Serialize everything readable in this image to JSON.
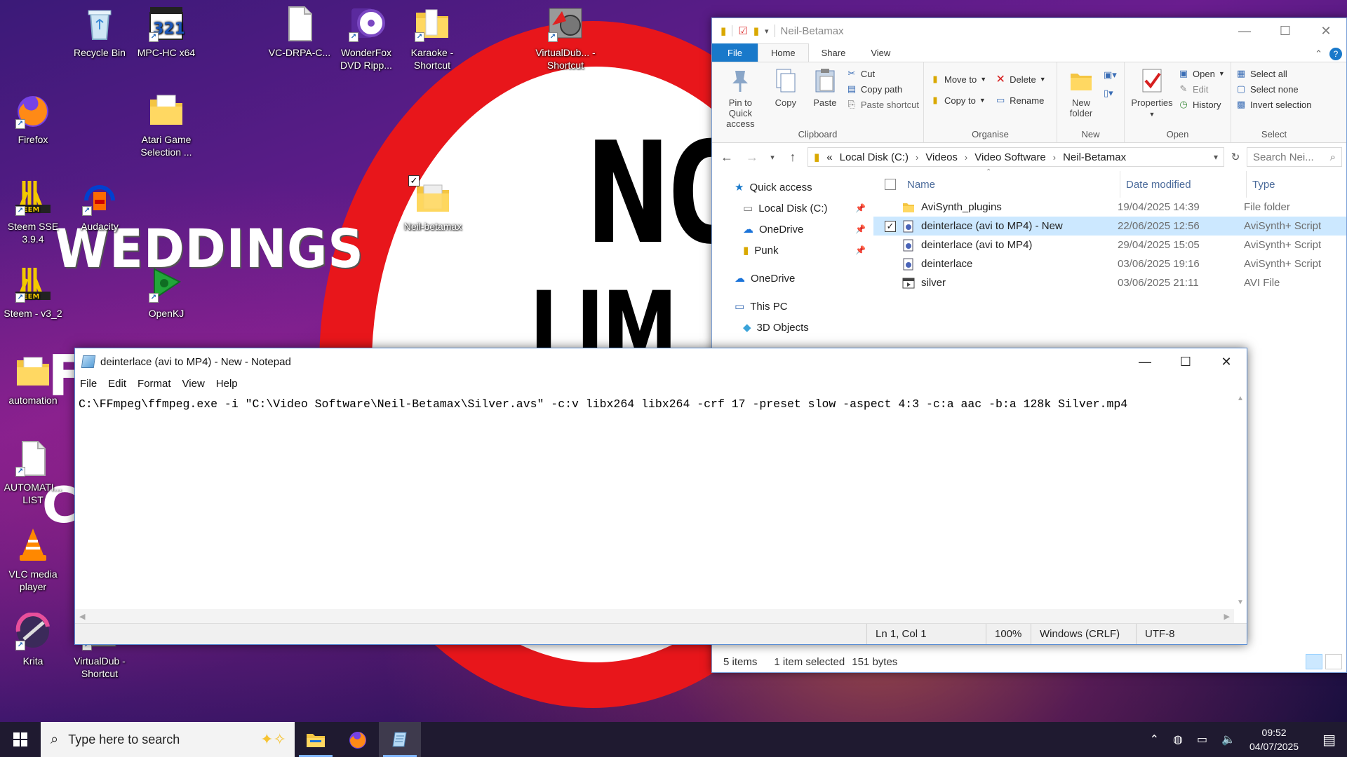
{
  "wallpaper": {
    "sign_top": "NO",
    "sign_bottom": "LIM",
    "weddings": "WEDDINGS",
    "frag1": "F",
    "frag2": "C"
  },
  "desktop_icons": [
    {
      "label": "Recycle Bin",
      "icon": "recycle-bin-icon"
    },
    {
      "label": "MPC-HC x64",
      "icon": "mpc-hc-icon"
    },
    {
      "label": "VC-DRPA-C...",
      "icon": "document-icon"
    },
    {
      "label": "WonderFox DVD Ripp...",
      "icon": "wonderfox-icon"
    },
    {
      "label": "Karaoke - Shortcut",
      "icon": "folder-icon"
    },
    {
      "label": "VirtualDub... - Shortcut",
      "icon": "virtualdub-icon"
    },
    {
      "label": "Firefox",
      "icon": "firefox-icon"
    },
    {
      "label": "Atari Game Selection ...",
      "icon": "folder-icon"
    },
    {
      "label": "Neil-betamax",
      "icon": "folder-icon"
    },
    {
      "label": "Steem SSE 3.9.4",
      "icon": "steem-icon"
    },
    {
      "label": "Audacity",
      "icon": "audacity-icon"
    },
    {
      "label": "Steem - v3_2",
      "icon": "steem-icon"
    },
    {
      "label": "OpenKJ",
      "icon": "openkj-icon"
    },
    {
      "label": "automation",
      "icon": "folder-icon"
    },
    {
      "label": "AUTOMATI... LIST",
      "icon": "document-icon"
    },
    {
      "label": "VLC media player",
      "icon": "vlc-icon"
    },
    {
      "label": "Krita",
      "icon": "krita-icon"
    },
    {
      "label": "VirtualDub - Shortcut",
      "icon": "virtualdub-icon"
    }
  ],
  "explorer": {
    "title": "Neil-Betamax",
    "tabs": {
      "file": "File",
      "home": "Home",
      "share": "Share",
      "view": "View"
    },
    "ribbon": {
      "clipboard": {
        "name": "Clipboard",
        "pin": "Pin to Quick access",
        "copy": "Copy",
        "paste": "Paste",
        "cut": "Cut",
        "copy_path": "Copy path",
        "paste_shortcut": "Paste shortcut"
      },
      "organise": {
        "name": "Organise",
        "move_to": "Move to",
        "copy_to": "Copy to",
        "delete": "Delete",
        "rename": "Rename"
      },
      "new": {
        "name": "New",
        "new_folder": "New folder"
      },
      "open": {
        "name": "Open",
        "properties": "Properties",
        "open": "Open",
        "edit": "Edit",
        "history": "History"
      },
      "select": {
        "name": "Select",
        "select_all": "Select all",
        "select_none": "Select none",
        "invert": "Invert selection"
      }
    },
    "address": {
      "prefix": "«",
      "crumbs": [
        "Local Disk (C:)",
        "Videos",
        "Video Software",
        "Neil-Betamax"
      ]
    },
    "search_placeholder": "Search Nei...",
    "nav": {
      "quick_access": "Quick access",
      "local_disk": "Local Disk (C:)",
      "onedrive1": "OneDrive",
      "punk": "Punk",
      "onedrive2": "OneDrive",
      "this_pc": "This PC",
      "objects3d": "3D Objects"
    },
    "columns": {
      "name": "Name",
      "date": "Date modified",
      "type": "Type"
    },
    "files": [
      {
        "name": "AviSynth_plugins",
        "date": "19/04/2025 14:39",
        "type": "File folder",
        "icon": "folder-icon",
        "selected": false
      },
      {
        "name": "deinterlace (avi to MP4) - New",
        "date": "22/06/2025 12:56",
        "type": "AviSynth+ Script",
        "icon": "avs-script-icon",
        "selected": true
      },
      {
        "name": "deinterlace (avi to MP4)",
        "date": "29/04/2025 15:05",
        "type": "AviSynth+ Script",
        "icon": "avs-script-icon",
        "selected": false
      },
      {
        "name": "deinterlace",
        "date": "03/06/2025 19:16",
        "type": "AviSynth+ Script",
        "icon": "avs-script-icon",
        "selected": false
      },
      {
        "name": "silver",
        "date": "03/06/2025 21:11",
        "type": "AVI File",
        "icon": "avi-file-icon",
        "selected": false
      }
    ],
    "status": {
      "items": "5 items",
      "selected": "1 item selected",
      "size": "151 bytes"
    }
  },
  "notepad": {
    "title": "deinterlace (avi to MP4) - New - Notepad",
    "menu": [
      "File",
      "Edit",
      "Format",
      "View",
      "Help"
    ],
    "content": "C:\\FFmpeg\\ffmpeg.exe -i \"C:\\Video Software\\Neil-Betamax\\Silver.avs\" -c:v libx264 libx264 -crf 17 -preset slow -aspect 4:3 -c:a aac -b:a 128k Silver.mp4",
    "status": {
      "pos": "Ln 1, Col 1",
      "zoom": "100%",
      "eol": "Windows (CRLF)",
      "enc": "UTF-8"
    }
  },
  "taskbar": {
    "search_placeholder": "Type here to search",
    "time": "09:52",
    "date": "04/07/2025"
  }
}
